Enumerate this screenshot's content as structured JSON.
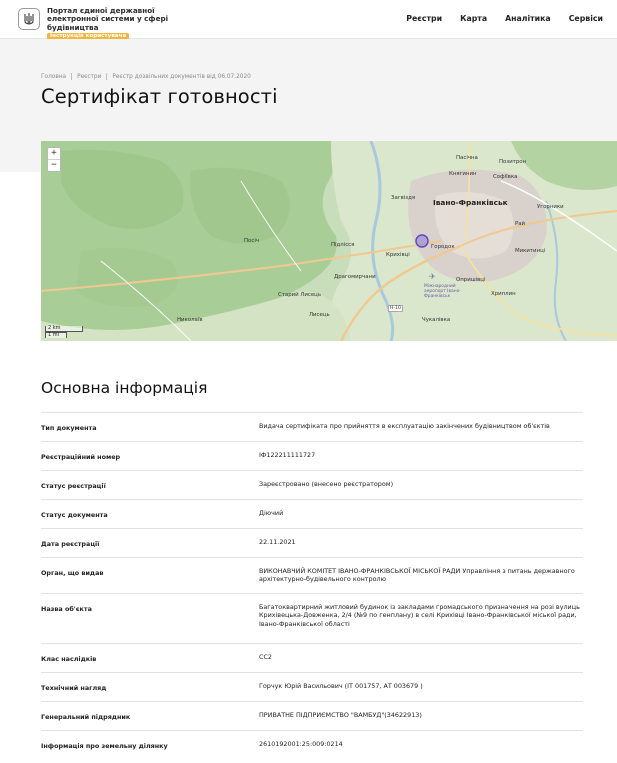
{
  "header": {
    "brand_line1": "Портал єдиної державної",
    "brand_line2": "електронної системи у сфері",
    "brand_line3": "будівництва",
    "brand_badge": "Інструкція користувача",
    "nav": [
      "Реєстри",
      "Карта",
      "Аналітика",
      "Сервіси"
    ]
  },
  "breadcrumbs": [
    "Головна",
    "Реєстри",
    "Реєстр дозвільних документів від 06.07.2020"
  ],
  "page_title": "Сертифікат готовності",
  "map": {
    "zoom_in": "+",
    "zoom_out": "−",
    "scale_km": "2 km",
    "scale_mi": "1 mi",
    "labels": {
      "city": "Івано-Франківськ",
      "pasichna": "Пасічна",
      "pozytron": "Позитрон",
      "khryplyn": "Хриплин",
      "uhornyky": "Угорники",
      "opryshivtsi": "Опришівці",
      "krykhivtsi": "Крихівці",
      "posich": "Посіч",
      "pidlissia": "Підлісся",
      "dragomyrchany": "Драгомирчани",
      "staryi_lysets": "Старий Лисець",
      "lysets": "Лисець",
      "zahvizdia": "Загвіздя",
      "chukalivka": "Чукалівка",
      "mykytyntsi": "Микитинці",
      "sofiivka": "Софіївка",
      "kniahyn": "Княгинин",
      "rai": "Рай",
      "nykolaiv": "Николаїв",
      "gorodok": "Городок",
      "road_h10": "Н-10",
      "airport": "Міжнародний аеропорт Івано-Франківськ"
    }
  },
  "section_title": "Основна інформація",
  "rows": [
    {
      "label": "Тип документа",
      "value": "Видача сертифіката про прийняття в експлуатацію закінчених будівництвом об'єктів"
    },
    {
      "label": "Реєстраційний номер",
      "value": "ІФ122211111727"
    },
    {
      "label": "Статус реєстрації",
      "value": "Зареєстровано (внесено реєстратором)"
    },
    {
      "label": "Статус документа",
      "value": "Діючий"
    },
    {
      "label": "Дата реєстрації",
      "value": "22.11.2021"
    },
    {
      "label": "Орган, що видав",
      "value": "ВИКОНАВЧИЙ КОМІТЕТ ІВАНО-ФРАНКІВСЬКОЇ МІСЬКОЇ РАДИ Управління з питань державного архітектурно-будівельного контролю"
    },
    {
      "label": "Назва об'єкта",
      "value": "Багатоквартирний житловий будинок із закладами громадського призначення на розі вулиць Крихівецька-Довженка, 2/4 (№9 по генплану) в селі Крихівці Івано-Франківської міської ради, Івано-Франківської області"
    },
    {
      "label": "Клас наслідків",
      "value": "СС2"
    },
    {
      "label": "Технічний нагляд",
      "value": "Горчук Юрій Васильович (ІТ 001757, АТ 003679 )"
    },
    {
      "label": "Генеральний підрядник",
      "value": "ПРИВАТНЕ ПІДПРИЄМСТВО \"ВАМБУД\"(34622913)"
    },
    {
      "label": "Інформація про земельну ділянку",
      "value": "2610192001:25:009:0214"
    }
  ]
}
